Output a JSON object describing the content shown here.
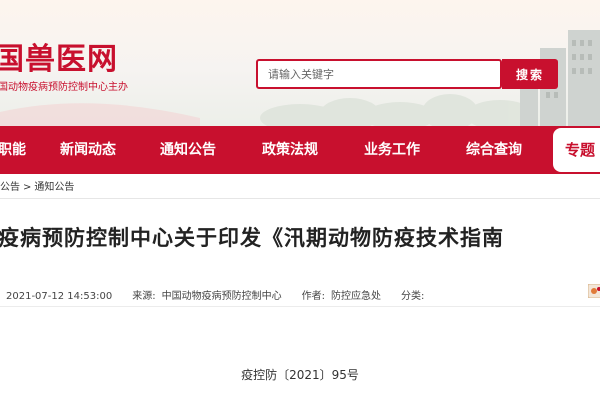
{
  "header": {
    "logo_title": "国兽医网",
    "logo_subtitle": "国动物疫病预防控制中心主办",
    "search_placeholder": "请输入关键字",
    "search_button": "搜索"
  },
  "nav": {
    "items": [
      "职能",
      "新闻动态",
      "通知公告",
      "政策法规",
      "业务工作",
      "综合查询"
    ],
    "special": "专题"
  },
  "breadcrumb": {
    "items": [
      "公告",
      "通知公告"
    ],
    "separator": ">"
  },
  "article": {
    "title": "疫病预防控制中心关于印发《汛期动物防疫技术指南",
    "meta": {
      "date": "2021-07-12 14:53:00",
      "source_label": "来源:",
      "source": "中国动物疫病预防控制中心",
      "author_label": "作者:",
      "author": "防控应急处",
      "category_label": "分类:"
    },
    "doc_number": "疫控防〔2021〕95号"
  },
  "colors": {
    "brand_red": "#c8102e",
    "background": "#ffffff"
  },
  "icons": {
    "share": "share-icon"
  }
}
